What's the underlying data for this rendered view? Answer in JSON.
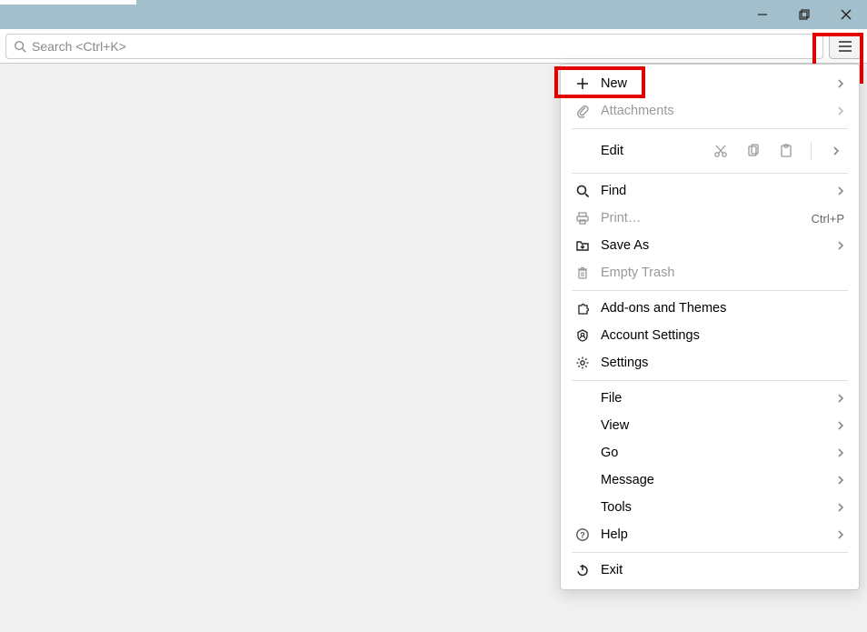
{
  "titlebar": {},
  "search": {
    "placeholder": "Search <Ctrl+K>"
  },
  "menu": {
    "new": "New",
    "attachments": "Attachments",
    "edit": "Edit",
    "find": "Find",
    "print": "Print…",
    "print_shortcut": "Ctrl+P",
    "save_as": "Save As",
    "empty_trash": "Empty Trash",
    "addons": "Add-ons and Themes",
    "account": "Account Settings",
    "settings": "Settings",
    "file": "File",
    "view": "View",
    "go": "Go",
    "message": "Message",
    "tools": "Tools",
    "help": "Help",
    "exit": "Exit"
  }
}
